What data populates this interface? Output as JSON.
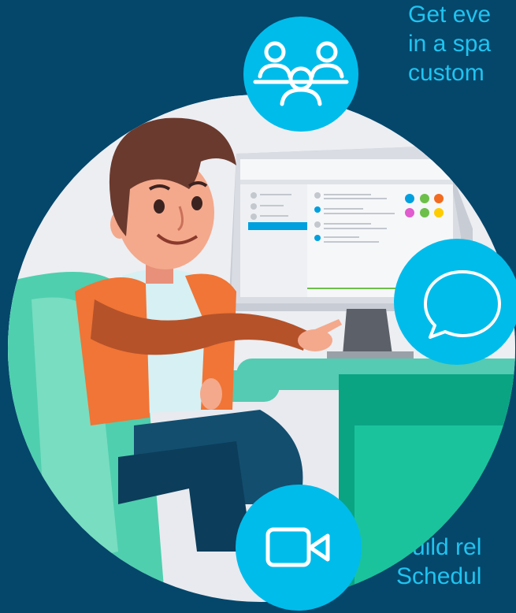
{
  "colors": {
    "background": "#04476b",
    "text_accent": "#20c3f0",
    "icon_circle": "#00bceb",
    "scene_bg": "#e8eaef",
    "desk": "#54cbb2",
    "chair": "#4fcfae",
    "jacket": "#f07536",
    "hair": "#6b3a2e"
  },
  "text": {
    "top_lines": [
      "Get eve",
      "in a spa",
      "custom"
    ],
    "bottom_lines": [
      "Build rel",
      "Schedul"
    ]
  },
  "icons": {
    "people": "people-group-icon",
    "chat": "chat-bubble-icon",
    "video": "video-camera-icon"
  },
  "screen_dots": [
    "#00a0df",
    "#6cc04a",
    "#f26b21",
    "#e05ccf",
    "#6cc04a",
    "#ffcc00"
  ]
}
